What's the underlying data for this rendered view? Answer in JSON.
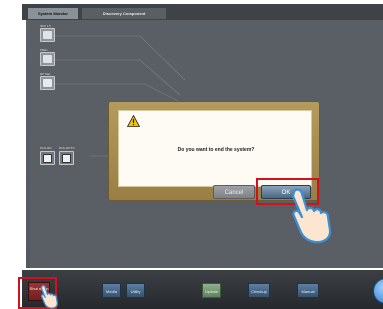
{
  "tabs": [
    {
      "label": "System Monitor",
      "active": true
    },
    {
      "label": "Discovery Component",
      "active": false
    }
  ],
  "devices": {
    "top_label_1": "IRIX 1.5",
    "top_label_2": "PREc",
    "top_label_3": "RP Mac",
    "console_label_1": "PAS-001",
    "console_label_2": "PAS-007FC"
  },
  "dialog": {
    "icon": "warning-icon",
    "message": "Do you want to end the system?",
    "cancel_label": "Cancel",
    "ok_label": "OK"
  },
  "bottombar": {
    "shutdown_label": "Shut down",
    "media_label": "Media",
    "utility_label": "Utility",
    "update_label": "Update",
    "checkup_label": "Checkup",
    "manual_label": "Manual"
  },
  "colors": {
    "highlight": "#d1121c",
    "dialog_frame": "#b49a5c",
    "ok_button": "#4c6782",
    "update_button": "#5f825c"
  }
}
